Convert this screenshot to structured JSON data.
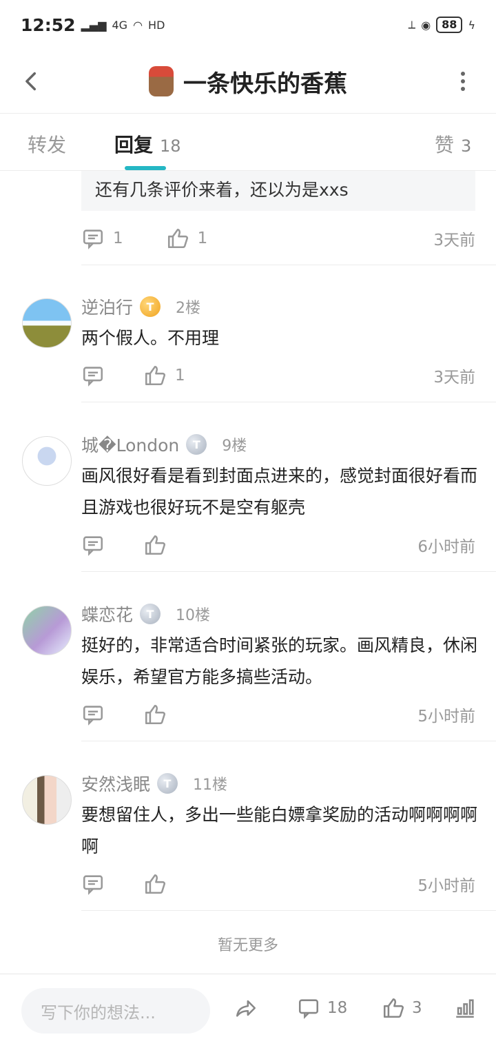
{
  "status_bar": {
    "time": "12:52",
    "network": "4G",
    "hd": "HD",
    "battery": "88"
  },
  "header": {
    "title": "一条快乐的香蕉"
  },
  "tabs": {
    "forward": "转发",
    "reply": "回复",
    "reply_count": "18",
    "like": "赞",
    "like_count": "3"
  },
  "top_comment": {
    "quote": "还有几条评价来着，还以为是xxs",
    "reply_count": "1",
    "like_count": "1",
    "time": "3天前"
  },
  "comments": [
    {
      "user": "逆泊行",
      "badge": "T",
      "floor": "2楼",
      "text": "两个假人。不用理",
      "like_count": "1",
      "time": "3天前"
    },
    {
      "user": "城�London",
      "badge": "T",
      "floor": "9楼",
      "text": "画风很好看是看到封面点进来的，感觉封面很好看而且游戏也很好玩不是空有躯壳",
      "like_count": "",
      "time": "6小时前"
    },
    {
      "user": "蝶恋花",
      "badge": "T",
      "floor": "10楼",
      "text": "挺好的，非常适合时间紧张的玩家。画风精良，休闲娱乐，希望官方能多搞些活动。",
      "like_count": "",
      "time": "5小时前"
    },
    {
      "user": "安然浅眠",
      "badge": "T",
      "floor": "11楼",
      "text": "要想留住人，多出一些能白嫖拿奖励的活动啊啊啊啊啊",
      "like_count": "",
      "time": "5小时前"
    }
  ],
  "footer_note": "暂无更多",
  "bottom_bar": {
    "placeholder": "写下你的想法...",
    "comment_count": "18",
    "like_count": "3"
  },
  "colors": {
    "accent": "#25b7c4",
    "muted": "#999999"
  },
  "icons": [
    "back-icon",
    "more-icon",
    "comment-icon",
    "like-icon",
    "share-icon",
    "stats-icon"
  ]
}
